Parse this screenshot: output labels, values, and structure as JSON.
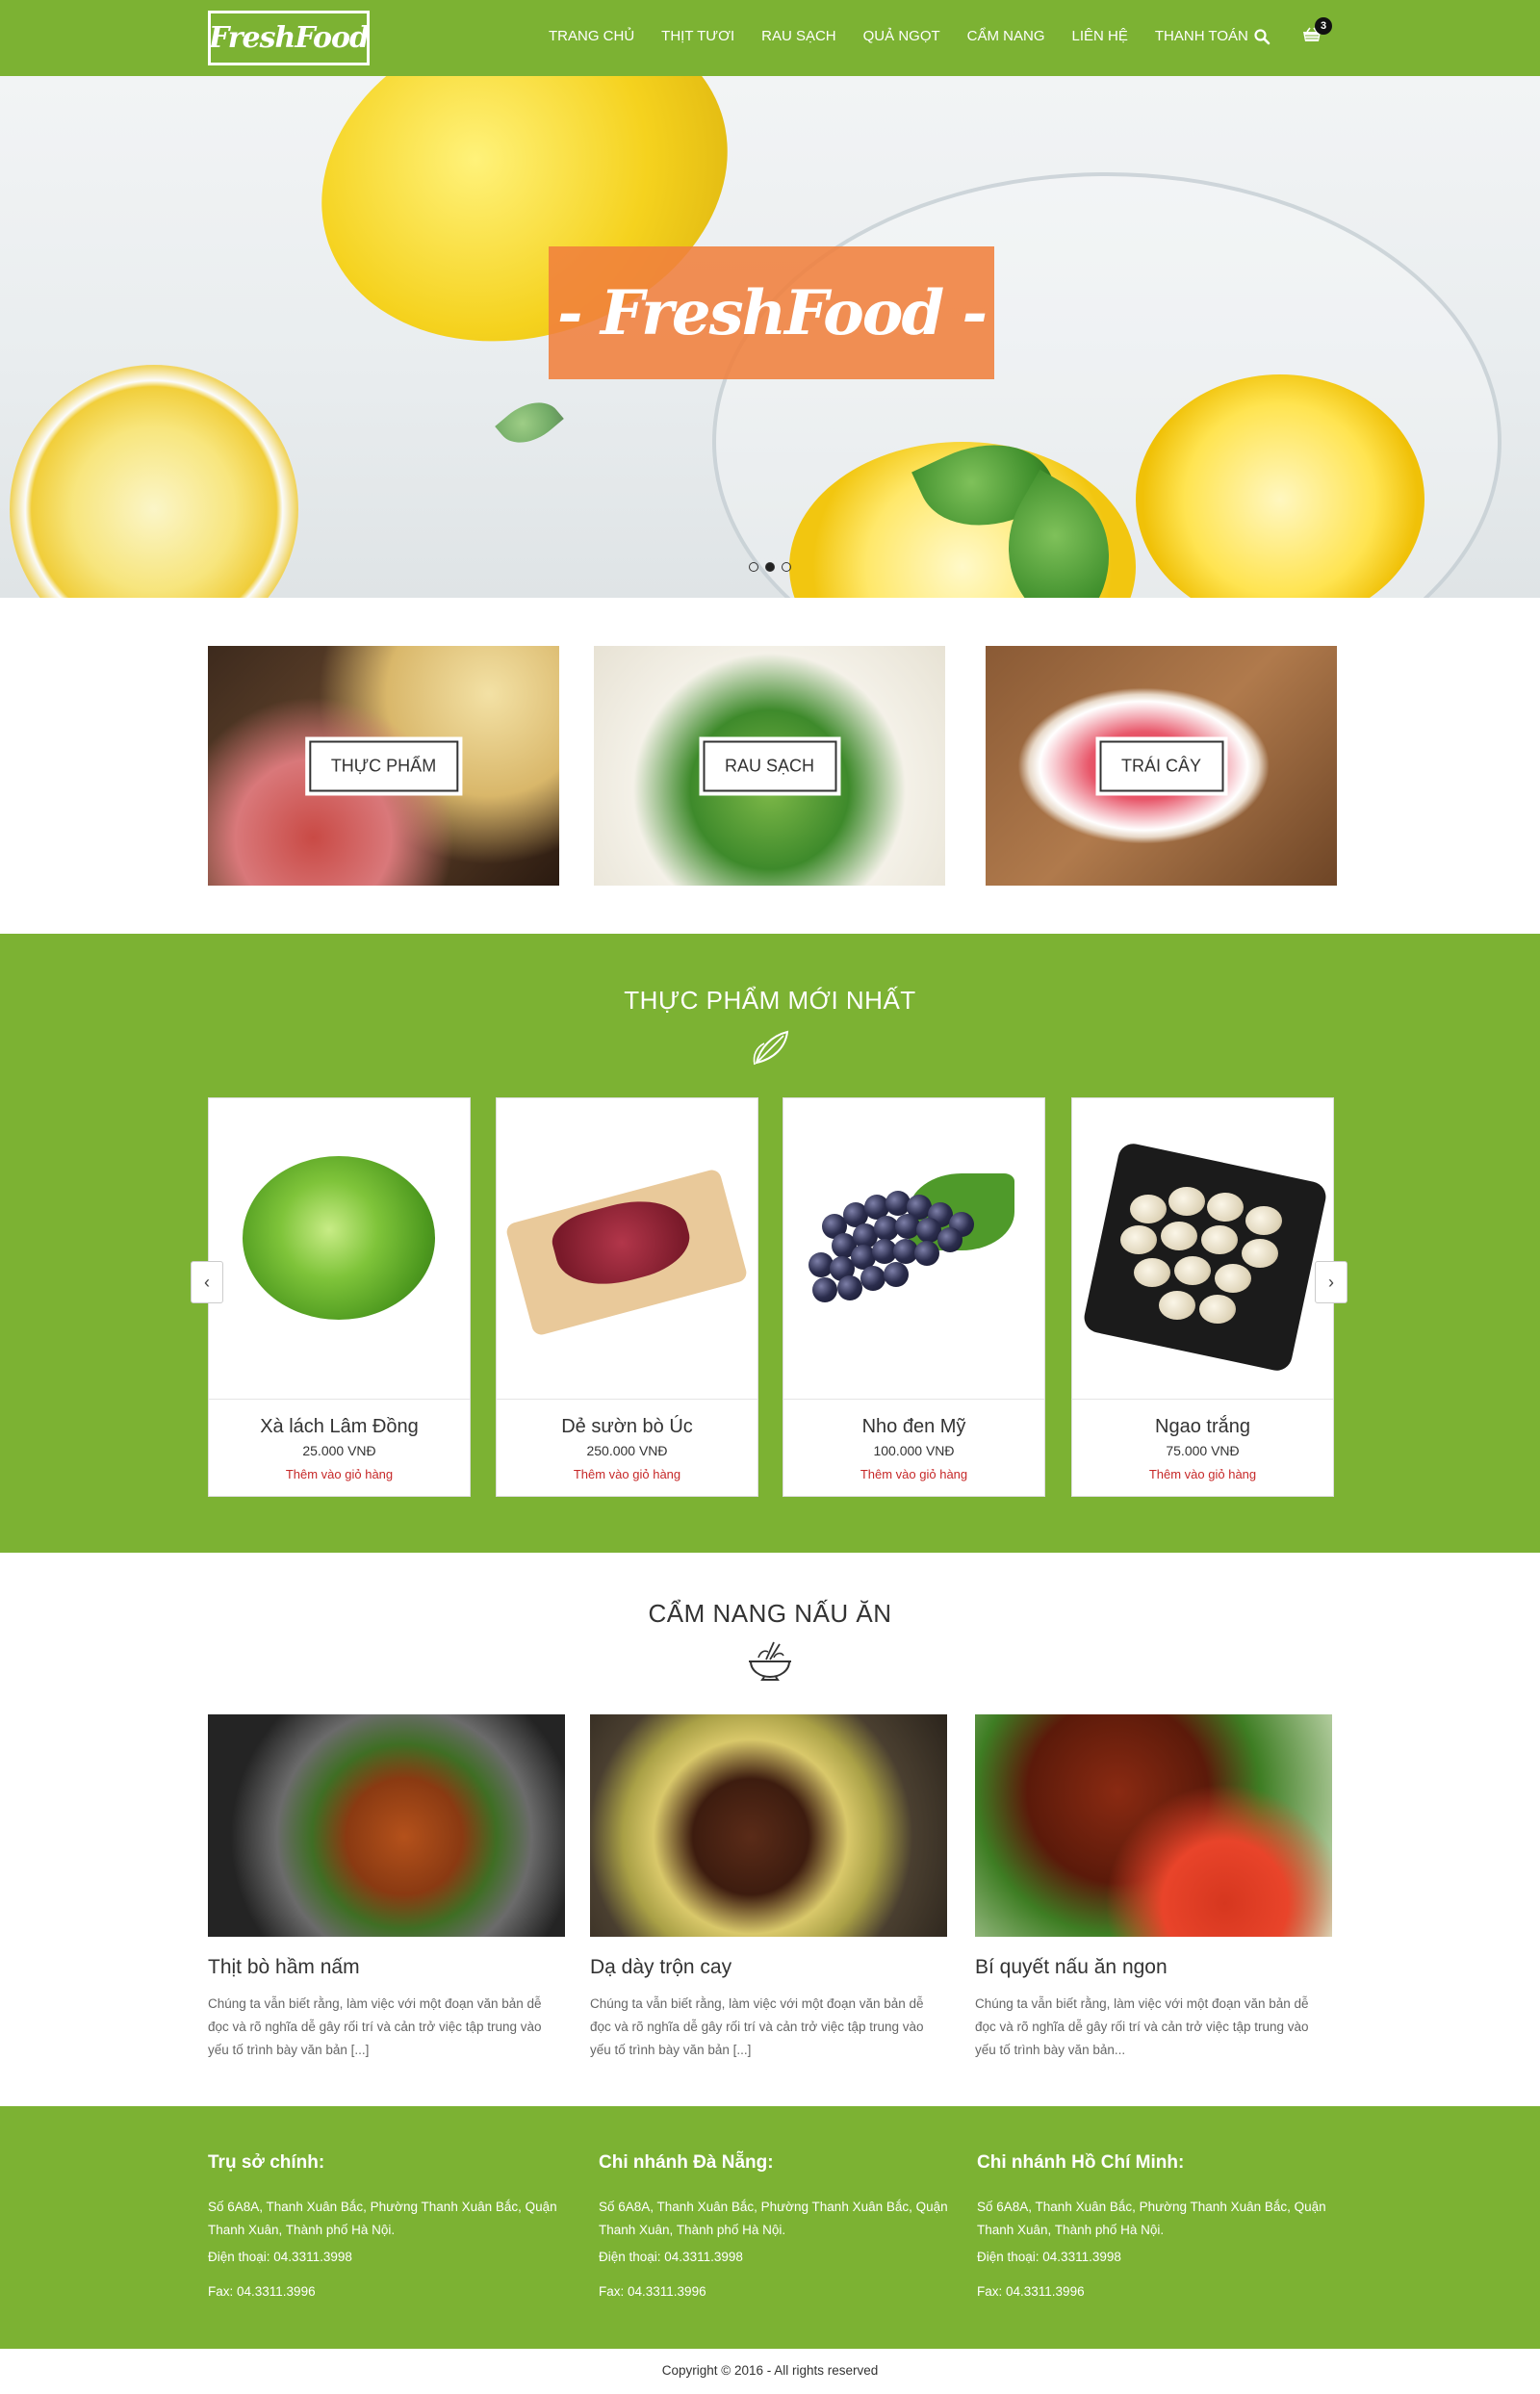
{
  "header": {
    "logo_text": "FreshFood",
    "nav": [
      "TRANG CHỦ",
      "THỊT TƯƠI",
      "RAU SẠCH",
      "QUẢ NGỌT",
      "CẨM NANG",
      "LIÊN HỆ",
      "THANH TOÁN"
    ],
    "search_icon": "search-icon",
    "cart_icon": "cart-icon",
    "cart_count": "3"
  },
  "hero": {
    "banner_text": "- FreshFood -",
    "slides": 3,
    "active_slide": 2
  },
  "categories": [
    {
      "label": "THỰC PHẨM"
    },
    {
      "label": "RAU SẠCH"
    },
    {
      "label": "TRÁI CÂY"
    }
  ],
  "new_products": {
    "title": "THỰC PHẨM MỚI NHẤT",
    "icon": "leaf-icon",
    "items": [
      {
        "name": "Xà lách Lâm Đồng",
        "price": "25.000 VNĐ",
        "action": "Thêm vào giỏ hàng"
      },
      {
        "name": "Dẻ sườn bò Úc",
        "price": "250.000 VNĐ",
        "action": "Thêm vào giỏ hàng"
      },
      {
        "name": "Nho đen Mỹ",
        "price": "100.000 VNĐ",
        "action": "Thêm vào giỏ hàng"
      },
      {
        "name": "Ngao trắng",
        "price": "75.000 VNĐ",
        "action": "Thêm vào giỏ hàng"
      }
    ],
    "prev_label": "‹",
    "next_label": "›"
  },
  "guide": {
    "title": "CẨM NANG NẤU ĂN",
    "icon": "bowl-icon",
    "posts": [
      {
        "title": "Thịt bò hầm nấm",
        "excerpt": "Chúng ta vẫn biết rằng, làm việc với một đoạn văn bản dễ đọc và rõ nghĩa dễ gây rối trí và cản trở việc tập trung vào yếu tố trình bày văn bản [...]"
      },
      {
        "title": "Dạ dày trộn cay",
        "excerpt": "Chúng ta vẫn biết rằng, làm việc với một đoạn văn bản dễ đọc và rõ nghĩa dễ gây rối trí và cản trở việc tập trung vào yếu tố trình bày văn bản [...]"
      },
      {
        "title": "Bí quyết nấu ăn ngon",
        "excerpt": "Chúng ta vẫn biết rằng, làm việc với một đoạn văn bản dễ đọc và rõ nghĩa dễ gây rối trí và cản trở việc tập trung vào yếu tố trình bày văn bản..."
      }
    ]
  },
  "footer": {
    "branches": [
      {
        "heading": "Trụ sở chính:",
        "address": "Số 6A8A, Thanh Xuân Bắc, Phường Thanh Xuân Bắc, Quận Thanh Xuân, Thành phố Hà Nội.",
        "phone": "Điện thoại: 04.3311.3998",
        "fax": "Fax: 04.3311.3996"
      },
      {
        "heading": "Chi nhánh Đà Nẵng:",
        "address": "Số 6A8A, Thanh Xuân Bắc, Phường Thanh Xuân Bắc, Quận Thanh Xuân, Thành phố Hà Nội.",
        "phone": "Điện thoại: 04.3311.3998",
        "fax": "Fax: 04.3311.3996"
      },
      {
        "heading": "Chi nhánh Hồ Chí Minh:",
        "address": "Số 6A8A, Thanh Xuân Bắc, Phường Thanh Xuân Bắc, Quận Thanh Xuân, Thành phố Hà Nội.",
        "phone": "Điện thoại: 04.3311.3998",
        "fax": "Fax: 04.3311.3996"
      }
    ],
    "copyright": "Copyright © 2016 - All rights reserved"
  },
  "colors": {
    "brand_green": "#7cb233",
    "accent_orange": "#f0803c",
    "add_to_cart_red": "#c62828"
  }
}
